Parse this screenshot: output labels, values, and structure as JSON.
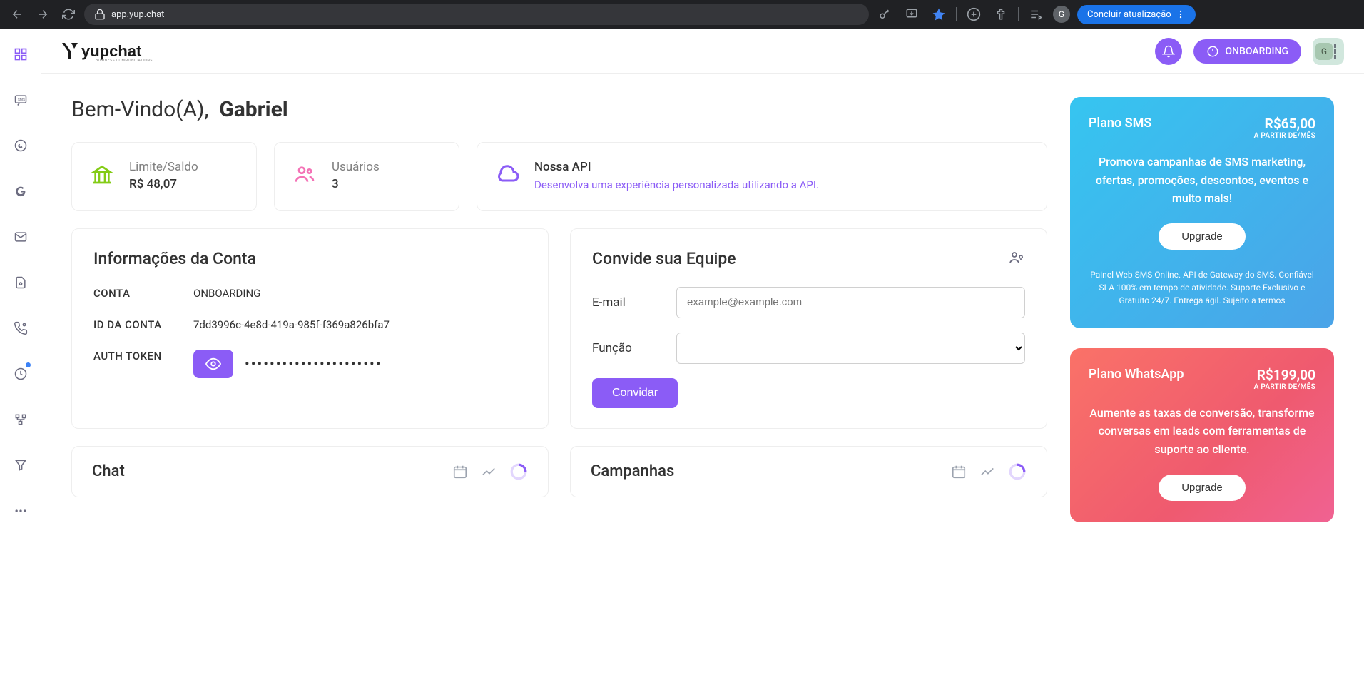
{
  "browser": {
    "url": "app.yup.chat",
    "profile_letter": "G",
    "finish_update": "Concluir atualização"
  },
  "topbar": {
    "onboarding": "ONBOARDING",
    "avatar_letter": "G"
  },
  "welcome": {
    "prefix": "Bem-Vindo(A),",
    "name": "Gabriel"
  },
  "stats": {
    "balance_label": "Limite/Saldo",
    "balance_value": "R$ 48,07",
    "users_label": "Usuários",
    "users_value": "3",
    "api_title": "Nossa API",
    "api_desc": "Desenvolva uma experiência personalizada utilizando a API."
  },
  "account": {
    "title": "Informações da Conta",
    "rows": {
      "conta_label": "CONTA",
      "conta_value": "ONBOARDING",
      "id_label": "ID DA CONTA",
      "id_value": "7dd3996c-4e8d-419a-985f-f369a826bfa7",
      "token_label": "AUTH TOKEN",
      "token_masked": "••••••••••••••••••••••"
    }
  },
  "invite": {
    "title": "Convide sua Equipe",
    "email_label": "E-mail",
    "email_placeholder": "example@example.com",
    "role_label": "Função",
    "button": "Convidar"
  },
  "mini": {
    "chat": "Chat",
    "campaigns": "Campanhas"
  },
  "plans": {
    "sms": {
      "name": "Plano SMS",
      "price": "R$65,00",
      "price_sub": "A PARTIR DE/MÊS",
      "desc": "Promova campanhas de SMS marketing, ofertas, promoções, descontos, eventos e muito mais!",
      "upgrade": "Upgrade",
      "fine": "Painel Web SMS Online. API de Gateway do SMS. Confiável SLA 100% em tempo de atividade. Suporte Exclusivo e Gratuito 24/7. Entrega ágil. Sujeito a termos"
    },
    "wa": {
      "name": "Plano WhatsApp",
      "price": "R$199,00",
      "price_sub": "A PARTIR DE/MÊS",
      "desc": "Aumente as taxas de conversão, transforme conversas em leads com ferramentas de suporte ao cliente.",
      "upgrade": "Upgrade"
    }
  }
}
